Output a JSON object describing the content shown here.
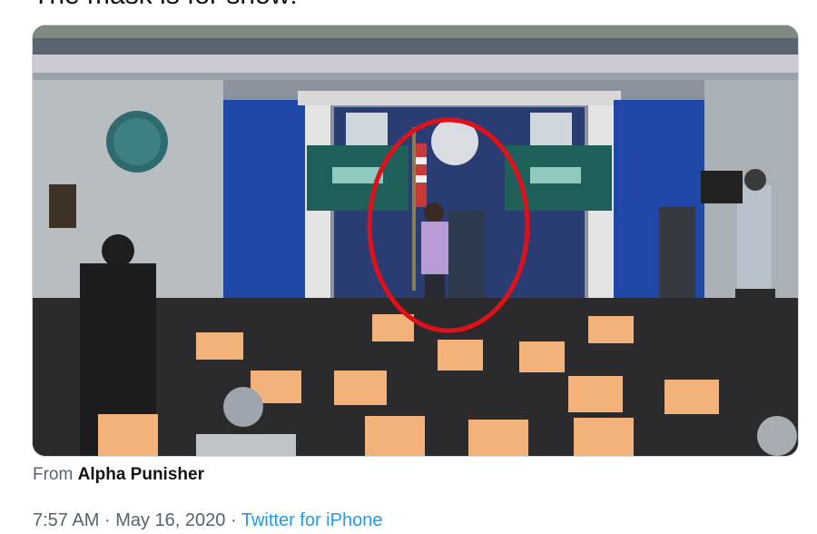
{
  "tweet": {
    "text": "The mask is for show!",
    "source_prefix": "From",
    "source_author": "Alpha Punisher",
    "time": "7:57 AM",
    "separator": "·",
    "date": "May 16, 2020",
    "client": "Twitter for iPhone"
  },
  "media": {
    "type": "video-still",
    "scene": "briefing-room",
    "annotation_color": "#e0101a",
    "chair_color": "#f3b27a",
    "backdrop_color": "#1f47a8"
  }
}
